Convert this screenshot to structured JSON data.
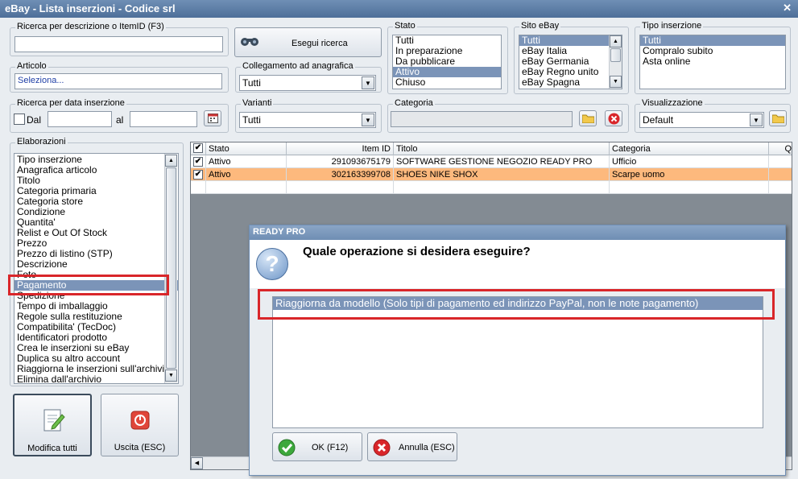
{
  "window": {
    "title": "eBay - Lista inserzioni - Codice srl",
    "close_glyph": "✕"
  },
  "search": {
    "label": "Ricerca per descrizione o ItemID (F3)",
    "value": "",
    "button_label": "Esegui ricerca"
  },
  "articolo": {
    "label": "Articolo",
    "value": "Seleziona..."
  },
  "collegamento": {
    "label": "Collegamento ad anagrafica",
    "value": "Tutti"
  },
  "stato": {
    "label": "Stato",
    "items": [
      "Tutti",
      "In preparazione",
      "Da pubblicare",
      "Attivo",
      "Chiuso"
    ],
    "selected_index": 3
  },
  "sito": {
    "label": "Sito eBay",
    "items": [
      "Tutti",
      "eBay Italia",
      "eBay Germania",
      "eBay Regno unito",
      "eBay Spagna"
    ],
    "selected_index": 0
  },
  "tipo": {
    "label": "Tipo inserzione",
    "items": [
      "Tutti",
      "Compralo subito",
      "Asta online"
    ],
    "selected_index": 0
  },
  "data_inserzione": {
    "label": "Ricerca per data inserzione",
    "dal_label": "Dal",
    "al_label": "al",
    "dal_value": "",
    "al_value": ""
  },
  "varianti": {
    "label": "Varianti",
    "value": "Tutti"
  },
  "categoria": {
    "label": "Categoria",
    "value": ""
  },
  "visualizzazione": {
    "label": "Visualizzazione",
    "value": "Default"
  },
  "elaborazioni": {
    "label": "Elaborazioni",
    "items": [
      "Tipo inserzione",
      "Anagrafica articolo",
      "Titolo",
      "Categoria primaria",
      "Categoria store",
      "Condizione",
      "Quantita'",
      "Relist e Out Of Stock",
      "Prezzo",
      "Prezzo di listino (STP)",
      "Descrizione",
      "Foto",
      "Pagamento",
      "Spedizione",
      "Tempo di imballaggio",
      "Regole sulla restituzione",
      "Compatibilita' (TecDoc)",
      "Identificatori prodotto",
      "Crea le inserzioni su eBay",
      "Duplica su altro account",
      "Riaggiorna le inserzioni sull'archivio",
      "Elimina dall'archivio"
    ],
    "selected_index": 12
  },
  "actions": {
    "modifica_label": "Modifica tutti",
    "uscita_label": "Uscita (ESC)"
  },
  "grid": {
    "headers": {
      "stato": "Stato",
      "item_id": "Item ID",
      "titolo": "Titolo",
      "categoria": "Categoria",
      "q": "Q"
    },
    "rows": [
      {
        "checked": "✔",
        "stato": "Attivo",
        "item_id": "291093675179",
        "titolo": "SOFTWARE GESTIONE NEGOZIO READY PRO",
        "categoria": "Ufficio"
      },
      {
        "checked": "✔",
        "stato": "Attivo",
        "item_id": "302163399708",
        "titolo": "SHOES NIKE SHOX",
        "categoria": "Scarpe uomo"
      }
    ],
    "selected_row": 1
  },
  "dialog": {
    "title": "READY PRO",
    "question": "Quale operazione si desidera eseguire?",
    "icon_glyph": "?",
    "option": "Riaggiorna da modello (Solo tipi di pagamento ed indirizzo PayPal, non le note pagamento)",
    "ok_label": "OK (F12)",
    "annulla_label": "Annulla (ESC)"
  },
  "colors": {
    "highlight_red": "#d9262a",
    "selection_blue": "#7b94b8",
    "row_orange": "#fdb97d"
  }
}
